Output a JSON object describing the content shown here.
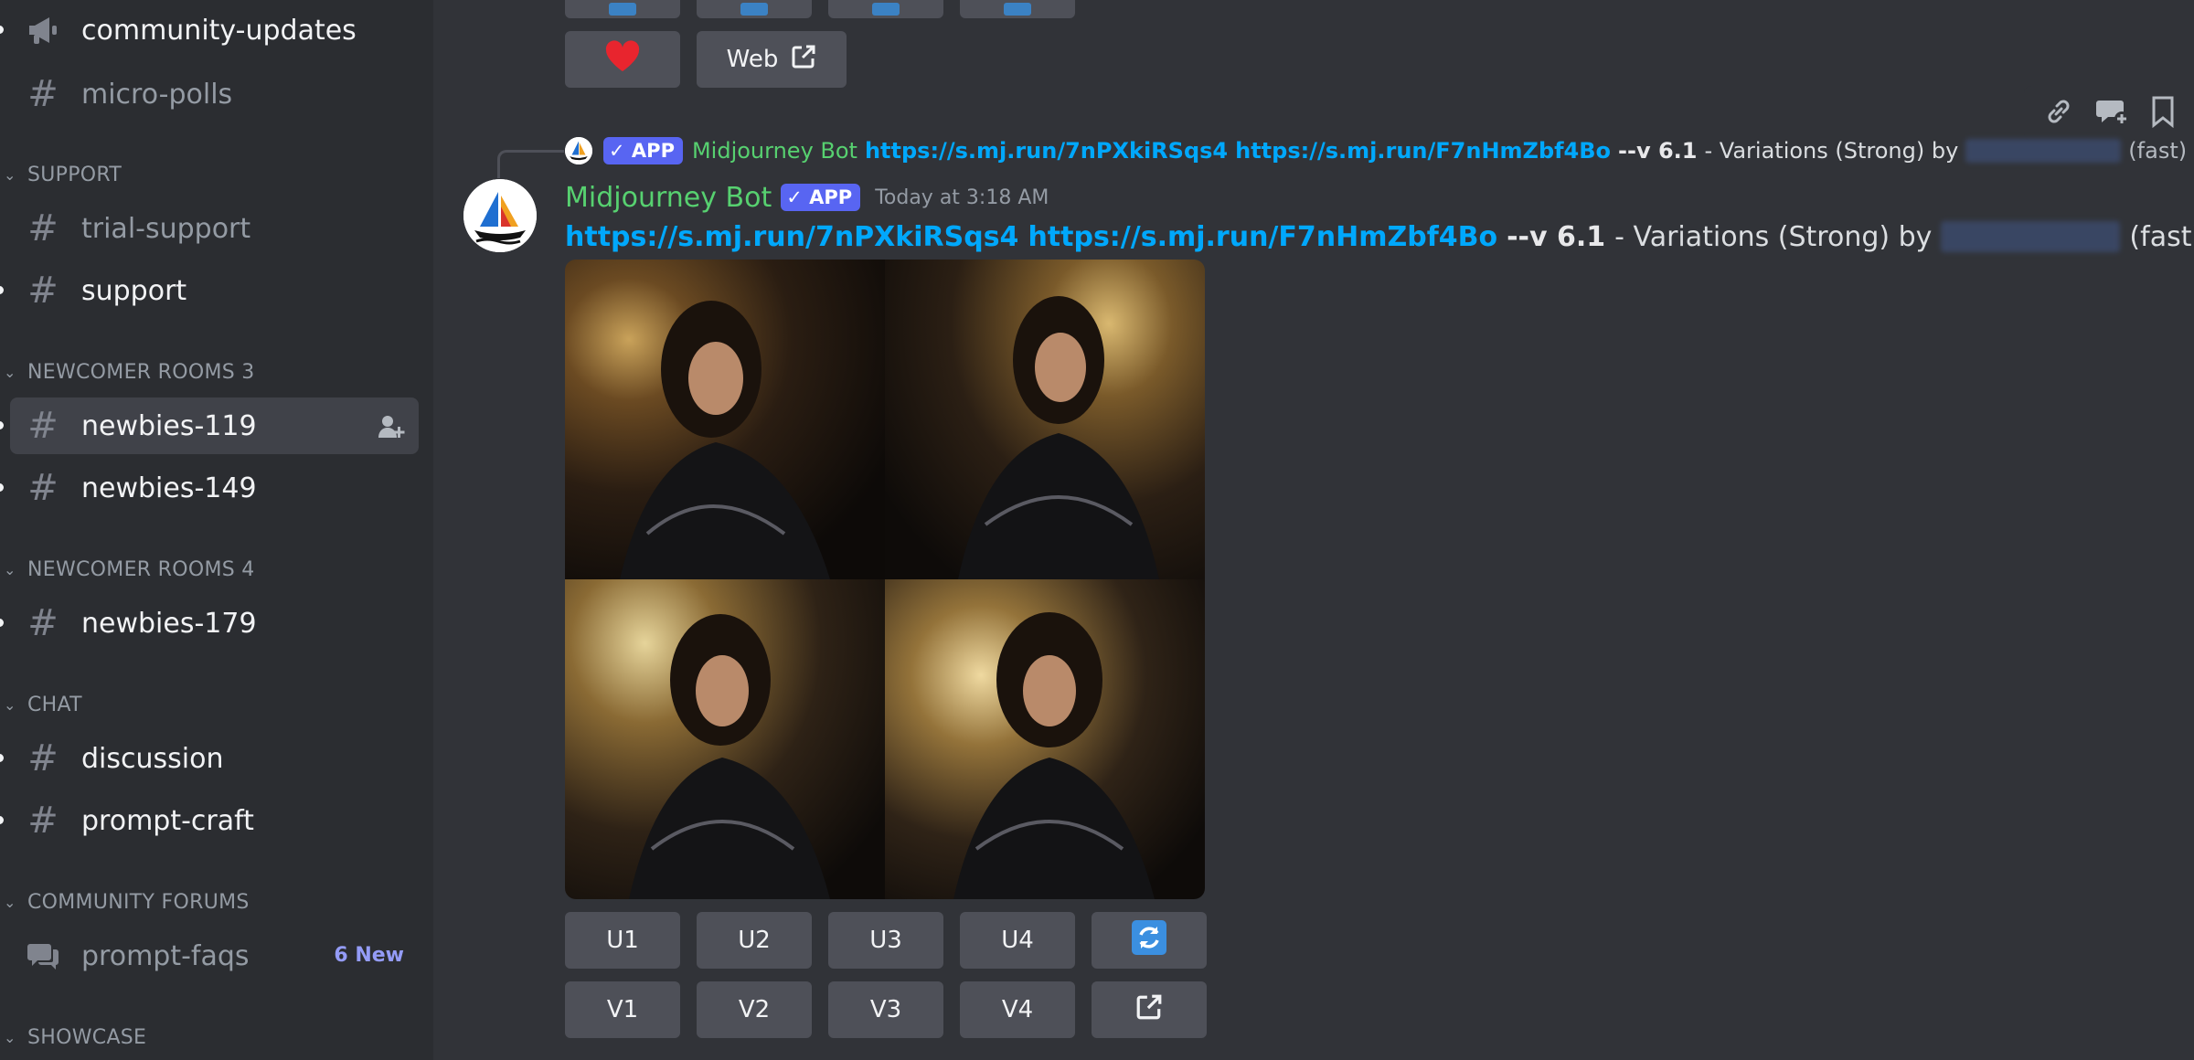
{
  "sidebar": {
    "channels": [
      {
        "name": "community-updates",
        "icon": "megaphone-icon"
      },
      {
        "name": "micro-polls",
        "icon": "hash-icon"
      },
      {
        "name": "trial-support",
        "icon": "hash-icon"
      },
      {
        "name": "support",
        "icon": "hash-thread-icon"
      },
      {
        "name": "newbies-119",
        "icon": "hash-thread-icon"
      },
      {
        "name": "newbies-149",
        "icon": "hash-thread-icon"
      },
      {
        "name": "newbies-179",
        "icon": "hash-thread-icon"
      },
      {
        "name": "discussion",
        "icon": "hash-icon"
      },
      {
        "name": "prompt-craft",
        "icon": "hash-icon"
      },
      {
        "name": "prompt-faqs",
        "icon": "forum-icon",
        "badge": "6 New"
      }
    ],
    "categories": [
      "SUPPORT",
      "NEWCOMER ROOMS 3",
      "NEWCOMER ROOMS 4",
      "CHAT",
      "COMMUNITY FORUMS",
      "SHOWCASE"
    ]
  },
  "main": {
    "top_buttons": {
      "web_label": "Web"
    },
    "reply": {
      "bot_name": "Midjourney Bot",
      "app_tag": "APP",
      "link1": "https://s.mj.run/7nPXkiRSqs4",
      "link2": "https://s.mj.run/F7nHmZbf4Bo",
      "flag": "--v 6.1",
      "text": "- Variations (Strong) by",
      "suffix": "(fast)"
    },
    "message": {
      "bot_name": "Midjourney Bot",
      "app_tag": "APP",
      "timestamp": "Today at 3:18 AM",
      "link1": "https://s.mj.run/7nPXkiRSqs4",
      "link2": "https://s.mj.run/F7nHmZbf4Bo",
      "flag": "--v 6.1",
      "text": "- Variations (Strong) by",
      "suffix": "(fast)"
    },
    "upscale_buttons": [
      "U1",
      "U2",
      "U3",
      "U4"
    ],
    "variation_buttons": [
      "V1",
      "V2",
      "V3",
      "V4"
    ]
  },
  "colors": {
    "sidebar_bg": "#2b2d31",
    "main_bg": "#313338",
    "button_bg": "#4e5058",
    "link": "#00a8fc",
    "bot_name": "#57d170",
    "app_tag": "#5865f2",
    "new_badge": "#949cf7"
  }
}
